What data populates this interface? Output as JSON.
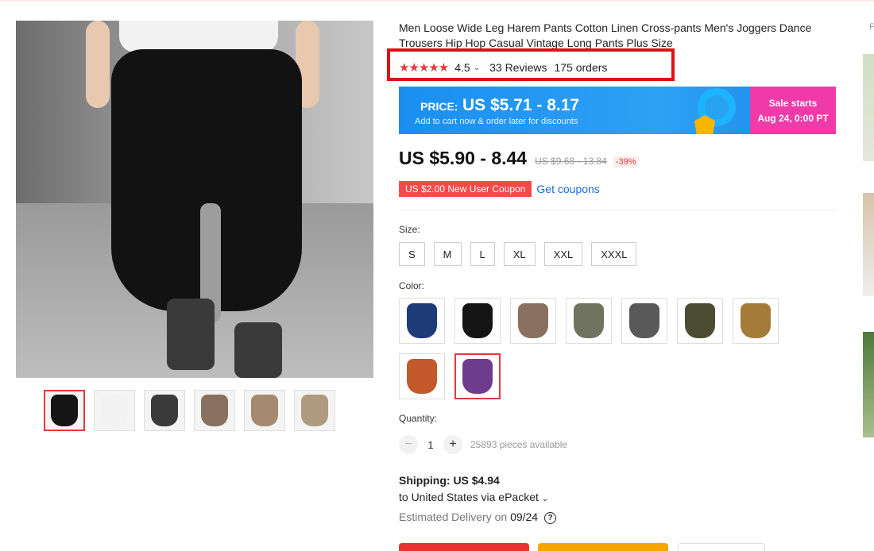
{
  "product": {
    "title": "Men Loose Wide Leg Harem Pants Cotton Linen Cross-pants Men's Joggers Dance Trousers Hip Hop Casual Vintage Long Pants Plus Size",
    "stars": "★★★★★",
    "rating": "4.5",
    "reviews": "33 Reviews",
    "orders": "175 orders"
  },
  "banner": {
    "price_label": "PRICE:",
    "price_value": "US $5.71 - 8.17",
    "subtitle": "Add to cart now & order later for discounts",
    "sale_line1": "Sale starts",
    "sale_line2": "Aug 24, 0:00 PT",
    "colors": {
      "bg": "#1a8ff0",
      "sale_bg": "#f03aa8"
    }
  },
  "pricing": {
    "price": "US $5.90 - 8.44",
    "original": "US $9.68 - 13.84",
    "discount": "-39%"
  },
  "coupon": {
    "label": "US $2.00 New User Coupon",
    "link": "Get coupons"
  },
  "size": {
    "label": "Size:",
    "options": [
      "S",
      "M",
      "L",
      "XL",
      "XXL",
      "XXXL"
    ]
  },
  "color": {
    "label": "Color:",
    "swatches": [
      "#1d3b77",
      "#151515",
      "#8a7060",
      "#6f7360",
      "#595959",
      "#4b4c33",
      "#a57b39",
      "#c3592a",
      "#6e3c8e"
    ],
    "selected_index": 8
  },
  "quantity": {
    "label": "Quantity:",
    "minus": "−",
    "value": "1",
    "plus": "+",
    "available": "25893 pieces available"
  },
  "shipping": {
    "label": "Shipping:",
    "cost": "US $4.94",
    "to": "to United States via ePacket",
    "delivery_label": "Estimated Delivery on",
    "delivery_date": "09/24",
    "help": "?"
  },
  "gallery": {
    "thumb_colors": [
      "#151515",
      "#f2f2f2",
      "#3a3a3a",
      "#8a7060",
      "#a58a70",
      "#b09a80"
    ],
    "selected_index": 0
  },
  "sidebar": {
    "label": "F"
  },
  "accent": "#e4393c"
}
